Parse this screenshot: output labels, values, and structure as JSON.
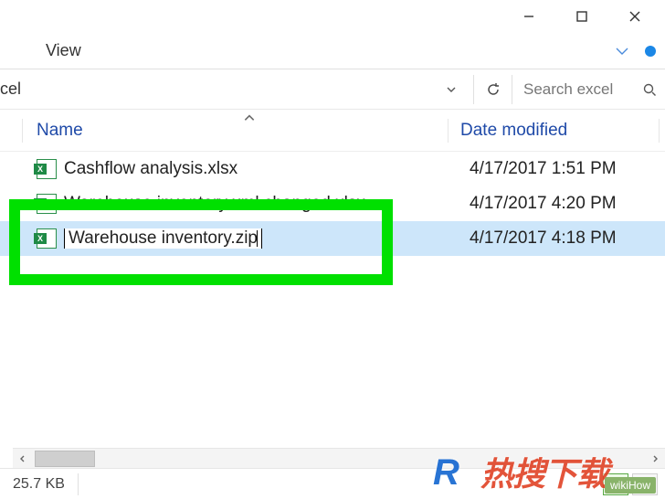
{
  "window": {
    "min_tooltip": "Minimize",
    "max_tooltip": "Maximize",
    "close_tooltip": "Close"
  },
  "ribbon": {
    "view_tab": "View"
  },
  "location": {
    "crumb_tail": "cel"
  },
  "search": {
    "placeholder": "Search excel"
  },
  "columns": {
    "name": "Name",
    "modified": "Date modified"
  },
  "files": [
    {
      "name": "Cashflow analysis.xlsx",
      "modified": "4/17/2017 1:51 PM"
    },
    {
      "name": "Warehouse inventory xml changed.xlsx",
      "modified": "4/17/2017 4:20 PM"
    },
    {
      "name": "Warehouse inventory.zip",
      "modified": "4/17/2017 4:18 PM"
    }
  ],
  "rename_value": "Warehouse inventory.zip",
  "status": {
    "selection_size": "25.7 KB"
  },
  "watermark": {
    "a": "R",
    "b": "热搜下载",
    "wh": "wikiHow"
  }
}
